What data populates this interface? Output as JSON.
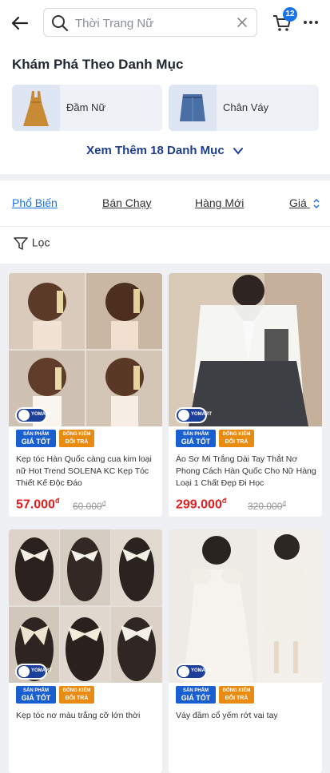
{
  "header": {
    "search_placeholder": "Thời Trang Nữ",
    "cart_count": "12"
  },
  "categories": {
    "title": "Khám Phá Theo Danh Mục",
    "items": [
      {
        "label": "Đầm Nữ"
      },
      {
        "label": "Chân Váy"
      }
    ],
    "see_more": "Xem Thêm 18 Danh Mục"
  },
  "sort": {
    "options": [
      "Phổ Biến",
      "Bán Chạy",
      "Hàng Mới",
      "Giá"
    ],
    "active": "Phổ Biến",
    "filter_label": "Lọc"
  },
  "badges": {
    "yomart": "YOMART",
    "good_price_top": "SẢN PHẨM",
    "good_price_main": "GIÁ TỐT",
    "return_top": "ĐỔNG KIỂM",
    "return_main": "ĐỔI TRẢ"
  },
  "products": [
    {
      "title": "Kẹp tóc Hàn Quốc càng cua kim loại nữ Hot Trend SOLENA KC Kẹp Tóc Thiết Kế Độc Đáo",
      "price": "57.000",
      "old_price": "60.000",
      "currency": "đ"
    },
    {
      "title": "Áo Sơ Mi Trắng Dài Tay Thắt Nơ Phong Cách Hàn Quốc Cho Nữ Hàng Loại 1 Chất Đẹp Đi Học",
      "price": "299.000",
      "old_price": "320.000",
      "currency": "đ"
    },
    {
      "title": "Kẹp tóc nơ màu trắng cỡ lớn thời",
      "price": "",
      "old_price": "",
      "currency": ""
    },
    {
      "title": "Váy đầm cổ yếm rớt vai tay",
      "price": "",
      "old_price": "",
      "currency": ""
    }
  ],
  "colors": {
    "accent": "#1a73e8",
    "price": "#e0201f",
    "navy": "#1d3d8f"
  }
}
